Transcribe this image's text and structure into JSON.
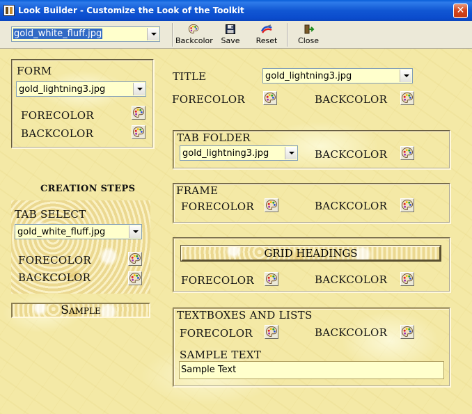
{
  "window": {
    "title": "Look Builder - Customize the Look of the Toolkit"
  },
  "toolbar": {
    "look_combo_value": "gold_white_fluff.jpg",
    "backcolor_label": "Backcolor",
    "save_label": "Save",
    "reset_label": "Reset",
    "close_label": "Close"
  },
  "form": {
    "label": "FORM",
    "image": "gold_lightning3.jpg",
    "forecolor_label": "FORECOLOR",
    "backcolor_label": "BACKCOLOR"
  },
  "creation_steps": {
    "label": "CREATION STEPS"
  },
  "tab_select": {
    "label": "TAB SELECT",
    "image": "gold_white_fluff.jpg",
    "forecolor_label": "FORECOLOR",
    "backcolor_label": "BACKCOLOR"
  },
  "sample": {
    "label": "Sample"
  },
  "title_section": {
    "label": "TITLE",
    "image": "gold_lightning3.jpg",
    "forecolor_label": "FORECOLOR",
    "backcolor_label": "BACKCOLOR"
  },
  "tab_folder": {
    "label": "TAB FOLDER",
    "image": "gold_lightning3.jpg",
    "backcolor_label": "BACKCOLOR"
  },
  "frame": {
    "label": "FRAME",
    "forecolor_label": "FORECOLOR",
    "backcolor_label": "BACKCOLOR"
  },
  "grid": {
    "headings_label": "GRID HEADINGS",
    "forecolor_label": "FORECOLOR",
    "backcolor_label": "BACKCOLOR"
  },
  "textboxes": {
    "label": "TEXTBOXES AND LISTS",
    "forecolor_label": "FORECOLOR",
    "backcolor_label": "BACKCOLOR",
    "sample_text_label": "SAMPLE TEXT",
    "sample_text_value": "Sample Text"
  },
  "icons": {
    "palette": "palette-icon",
    "save": "floppy-disk-icon",
    "reset": "reset-brush-icon",
    "close": "exit-door-icon"
  }
}
